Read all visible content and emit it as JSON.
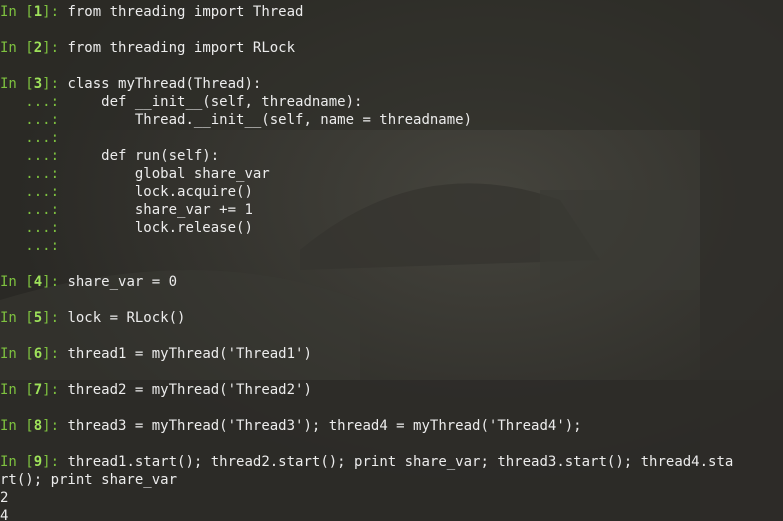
{
  "cells": [
    {
      "n": "1",
      "code": "from threading import Thread"
    },
    {
      "n": "2",
      "code": "from threading import RLock"
    },
    {
      "n": "3",
      "code": "class myThread(Thread):",
      "continuation": [
        "    def __init__(self, threadname):",
        "        Thread.__init__(self, name = threadname)",
        "",
        "    def run(self):",
        "        global share_var",
        "        lock.acquire()",
        "        share_var += 1",
        "        lock.release()",
        ""
      ]
    },
    {
      "n": "4",
      "code": "share_var = 0"
    },
    {
      "n": "5",
      "code": "lock = RLock()"
    },
    {
      "n": "6",
      "code": "thread1 = myThread('Thread1')"
    },
    {
      "n": "7",
      "code": "thread2 = myThread('Thread2')"
    },
    {
      "n": "8",
      "code": "thread3 = myThread('Thread3'); thread4 = myThread('Thread4');"
    },
    {
      "n": "9",
      "code": "thread1.start(); thread2.start(); print share_var; thread3.start(); thread4.sta",
      "wrap": "rt(); print share_var",
      "output": [
        "2",
        "4"
      ]
    }
  ],
  "prompt": {
    "in": "In [",
    "close": "]: ",
    "cont": "   ...: "
  },
  "colors": {
    "prompt": "#7ec23f",
    "number": "#9ee25a",
    "text": "#ececec",
    "background": "#2b2a26"
  }
}
